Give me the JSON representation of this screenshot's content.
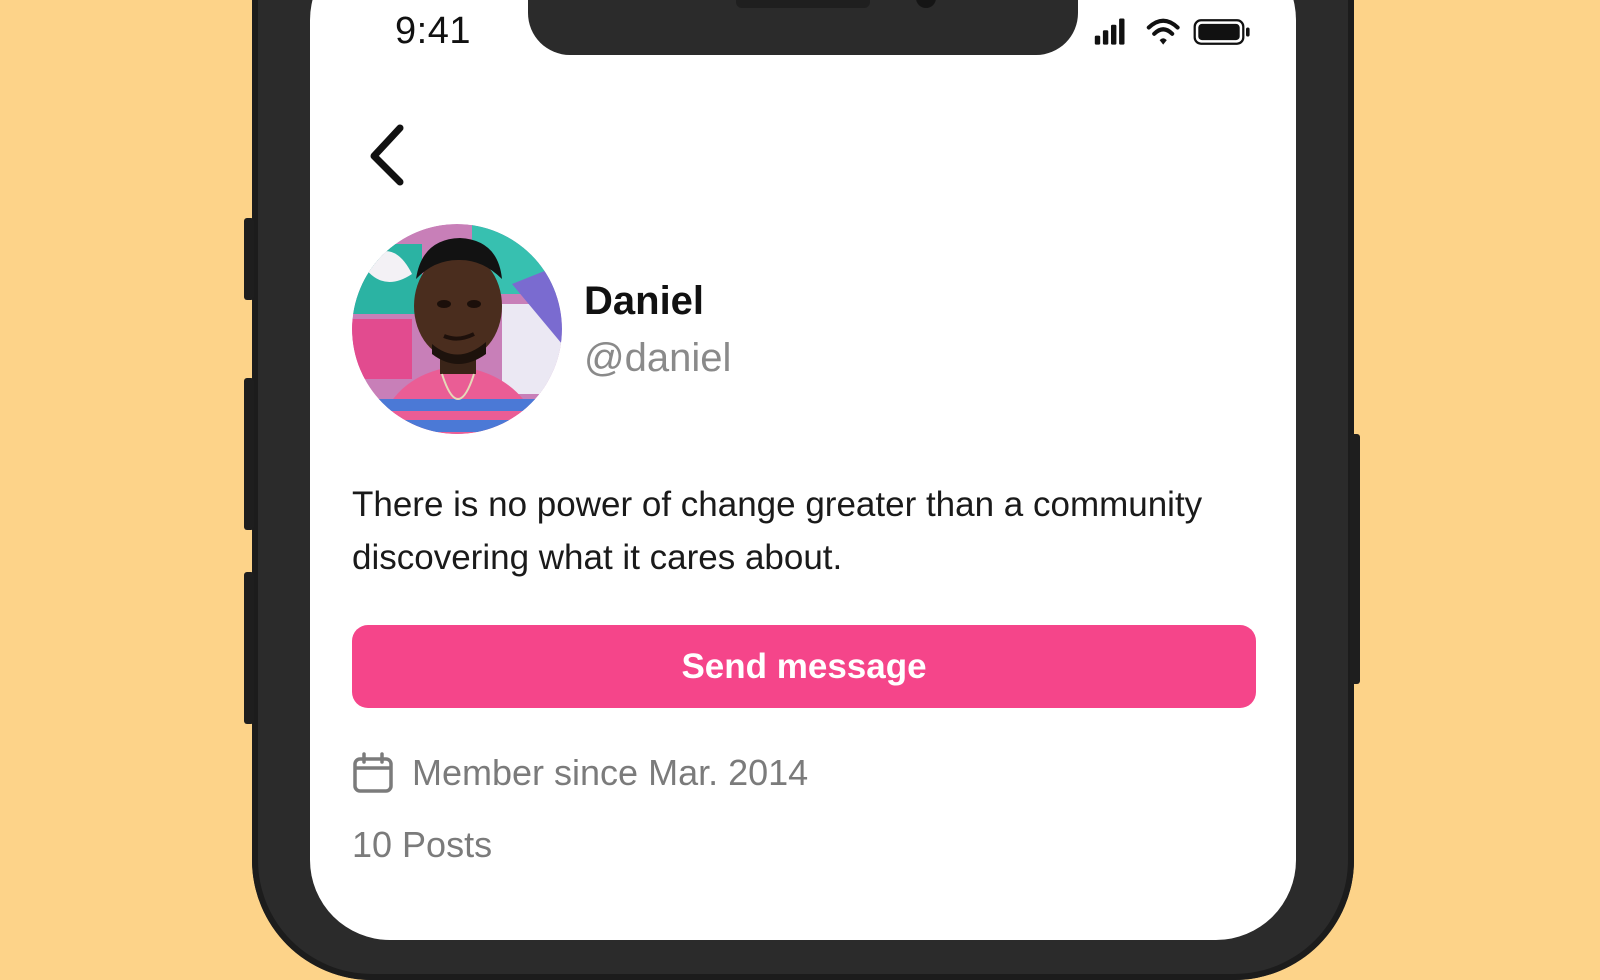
{
  "status_bar": {
    "time": "9:41",
    "icons": [
      "signal-icon",
      "wifi-icon",
      "battery-icon"
    ]
  },
  "nav": {
    "back_icon": "chevron-left-icon"
  },
  "profile": {
    "name": "Daniel",
    "handle": "@daniel",
    "bio": "There is no power of change greater than a community discovering what it cares about.",
    "avatar_alt": "Daniel"
  },
  "actions": {
    "send_message_label": "Send message"
  },
  "meta": {
    "member_since_icon": "calendar-icon",
    "member_since": "Member since Mar. 2014",
    "posts_partial": "10 Posts"
  },
  "colors": {
    "background": "#FDD389",
    "accent": "#F5458A",
    "phone_frame": "#2b2b2b"
  }
}
